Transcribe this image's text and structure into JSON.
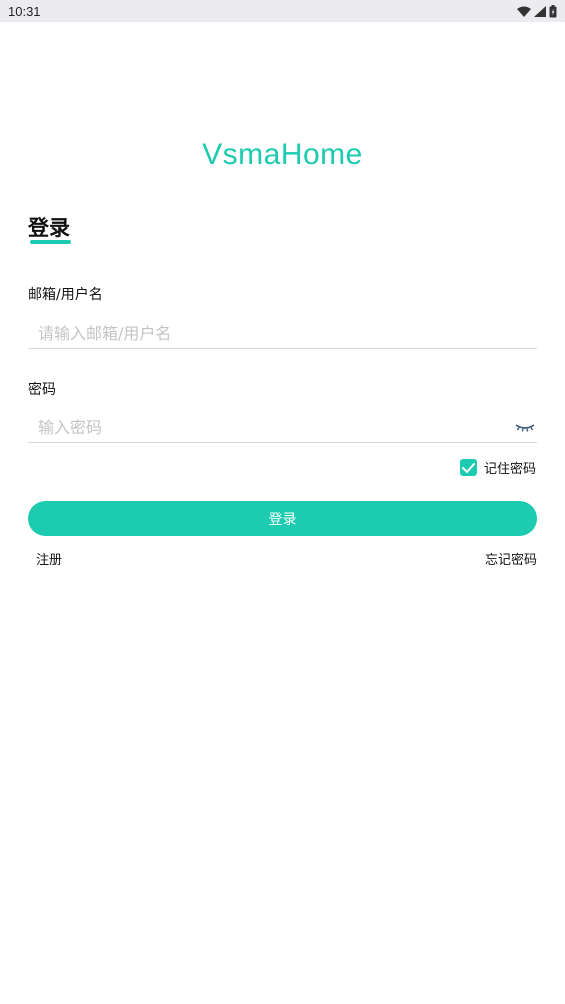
{
  "status_bar": {
    "time": "10:31",
    "icons": [
      "wifi-icon",
      "signal-icon",
      "battery-icon"
    ]
  },
  "brand": {
    "logo_text": "VsmaHome",
    "accent_color": "#1ccbb0"
  },
  "login": {
    "title": "登录",
    "username": {
      "label": "邮箱/用户名",
      "placeholder": "请输入邮箱/用户名",
      "value": ""
    },
    "password": {
      "label": "密码",
      "placeholder": "输入密码",
      "value": "",
      "visibility_icon": "eye-closed-icon"
    },
    "remember": {
      "label": "记住密码",
      "checked": true
    },
    "submit_label": "登录",
    "register_link": "注册",
    "forgot_link": "忘记密码"
  }
}
